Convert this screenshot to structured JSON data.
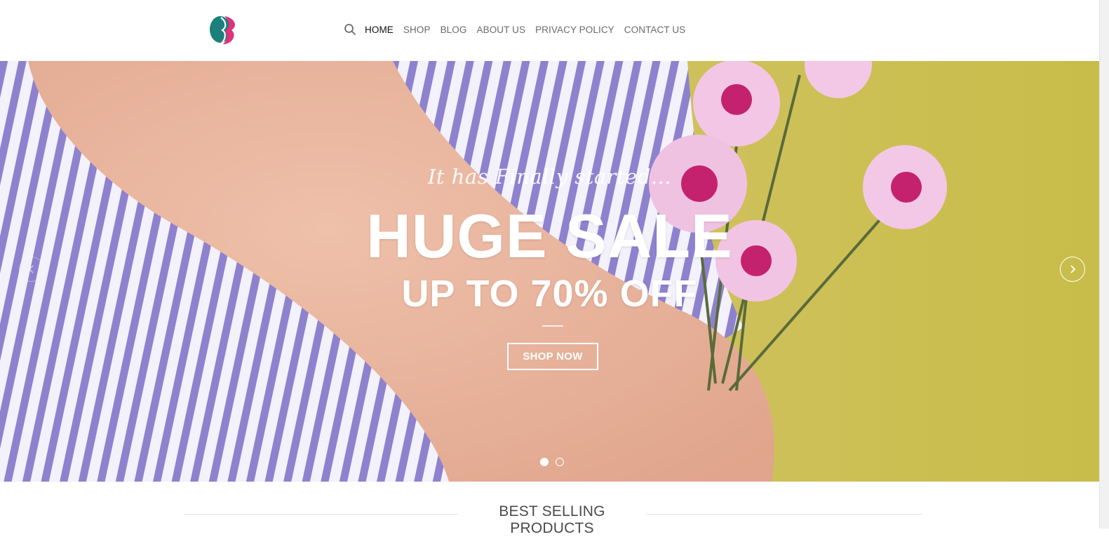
{
  "header": {
    "logo_icon": "brand-logo-icon",
    "search_icon": "search-icon",
    "nav": [
      {
        "label": "HOME",
        "active": true
      },
      {
        "label": "SHOP",
        "active": false
      },
      {
        "label": "BLOG",
        "active": false
      },
      {
        "label": "ABOUT US",
        "active": false
      },
      {
        "label": "PRIVACY POLICY",
        "active": false
      },
      {
        "label": "CONTACT US",
        "active": false
      }
    ]
  },
  "hero": {
    "tagline": "It has Finally started...",
    "headline": "HUGE SALE",
    "subline": "UP TO 70% OFF",
    "cta_label": "SHOP NOW",
    "prev_icon": "chevron-left-icon",
    "next_icon": "chevron-right-icon",
    "slide_count": 2,
    "active_slide": 1
  },
  "section": {
    "title": "BEST SELLING PRODUCTS"
  },
  "colors": {
    "brand_teal": "#1b7f7c",
    "brand_pink": "#e0317a",
    "text_dark": "#111111",
    "text_muted": "#6a6a6a"
  }
}
